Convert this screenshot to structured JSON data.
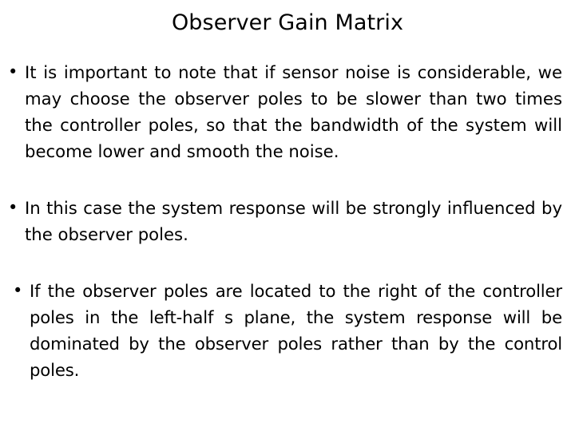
{
  "slide": {
    "title": "Observer Gain Matrix",
    "background_color": "#ffffff",
    "text_color": "#000000",
    "bullet_marker": "•",
    "bullets": [
      {
        "id": "bullet-sensor-noise",
        "text": "It is important to note that if sensor noise is considerable, we may choose the observer poles to be slower than two times the controller poles, so that the bandwidth of the system will become lower and smooth the noise."
      },
      {
        "id": "bullet-system-response",
        "text": "In this case the system response will be strongly influenced by the observer poles."
      },
      {
        "id": "bullet-pole-location",
        "text": "If the observer poles are located to the right of the controller poles in the left-half s plane, the system response will be dominated by the observer poles rather than by the control poles."
      }
    ]
  }
}
